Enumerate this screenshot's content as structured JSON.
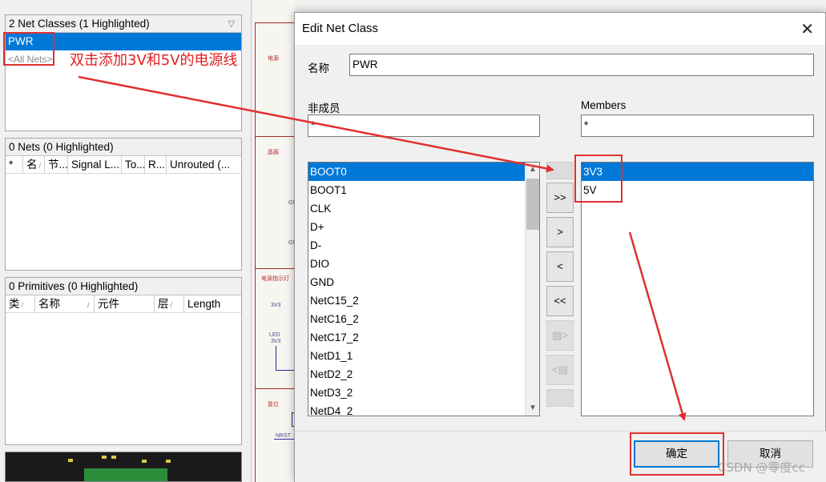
{
  "left_panel": {
    "net_classes": {
      "header": "2 Net Classes (1 Highlighted)",
      "items": [
        "PWR",
        "<All Nets>"
      ]
    },
    "nets": {
      "header": "0 Nets (0 Highlighted)",
      "columns": [
        "*",
        "名",
        "节...",
        "Signal L...",
        "To...",
        "R...",
        "Unrouted (..."
      ]
    },
    "primitives": {
      "header": "0 Primitives (0 Highlighted)",
      "columns": [
        "类",
        "名称",
        "元件",
        "层",
        "Length"
      ]
    }
  },
  "schematic": {
    "labels": [
      "电源",
      "晶振",
      "电源指示灯",
      "复位"
    ],
    "small": [
      "3V3",
      "LED",
      "3V3",
      "NRST",
      "GN",
      "GN"
    ]
  },
  "dialog": {
    "title": "Edit Net Class",
    "name_label": "名称",
    "name_value": "PWR",
    "non_members_label": "非成员",
    "non_members_filter": "*",
    "members_label": "Members",
    "members_filter": "*",
    "non_members": [
      "BOOT0",
      "BOOT1",
      "CLK",
      "D+",
      "D-",
      "DIO",
      "GND",
      "NetC15_2",
      "NetC16_2",
      "NetC17_2",
      "NetD1_1",
      "NetD2_2",
      "NetD3_2",
      "NetD4_2"
    ],
    "members": [
      "3V3",
      "5V"
    ],
    "buttons": {
      "add_all": ">>",
      "add": ">",
      "remove": "<",
      "remove_all": "<<",
      "ok": "确定",
      "cancel": "取消"
    }
  },
  "annotation": {
    "text": "双击添加3V和5V的电源线"
  },
  "watermark": "CSDN @零度cc",
  "colors": {
    "selection": "#0078d7",
    "annotation": "#e03030"
  }
}
